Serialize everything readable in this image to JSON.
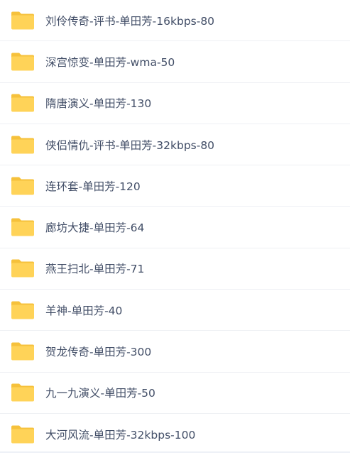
{
  "folder_icon": "folder-icon",
  "colors": {
    "folder_fill": "#ffd257",
    "folder_tab": "#f9c341",
    "text": "#424e67",
    "divider": "#eef0f4"
  },
  "files": [
    {
      "name": "刘伶传奇-评书-单田芳-16kbps-80"
    },
    {
      "name": "深宫惊变-单田芳-wma-50"
    },
    {
      "name": "隋唐演义-单田芳-130"
    },
    {
      "name": "侠侣情仇-评书-单田芳-32kbps-80"
    },
    {
      "name": "连环套-单田芳-120"
    },
    {
      "name": "廊坊大捷-单田芳-64"
    },
    {
      "name": "燕王扫北-单田芳-71"
    },
    {
      "name": "羊神-单田芳-40"
    },
    {
      "name": "贺龙传奇-单田芳-300"
    },
    {
      "name": "九一九演义-单田芳-50"
    },
    {
      "name": "大河风流-单田芳-32kbps-100"
    }
  ]
}
